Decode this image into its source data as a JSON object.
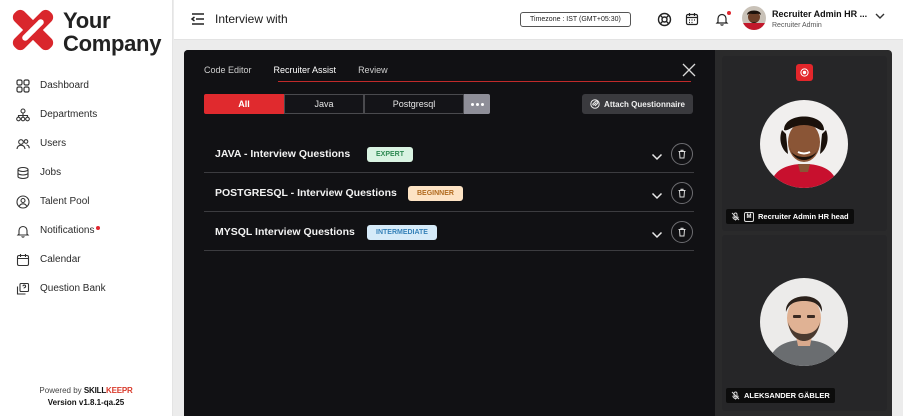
{
  "brand": {
    "logo_line1": "Your",
    "logo_line2": "Company",
    "powered_by": "Powered by",
    "skill": "SKILL",
    "keepr": "KEEPR",
    "version": "Version v1.8.1-qa.25"
  },
  "sidebar": {
    "items": [
      {
        "label": "Dashboard",
        "icon": "dashboard-icon"
      },
      {
        "label": "Departments",
        "icon": "departments-icon"
      },
      {
        "label": "Users",
        "icon": "users-icon"
      },
      {
        "label": "Jobs",
        "icon": "jobs-icon"
      },
      {
        "label": "Talent Pool",
        "icon": "talent-pool-icon"
      },
      {
        "label": "Notifications",
        "icon": "bell-icon"
      },
      {
        "label": "Calendar",
        "icon": "calendar-icon"
      },
      {
        "label": "Question Bank",
        "icon": "question-bank-icon"
      }
    ]
  },
  "header": {
    "title": "Interview with",
    "timezone": "Timezone : IST (GMT+05:30)",
    "user_name": "Recruiter Admin HR ...",
    "user_role": "Recruiter Admin"
  },
  "panel": {
    "tabs": [
      "Code Editor",
      "Recruiter Assist",
      "Review"
    ],
    "active_tab": "Recruiter Assist",
    "filters": [
      "All",
      "Java",
      "Postgresql"
    ],
    "active_filter": "All",
    "attach_label": "Attach Questionnaire",
    "questionnaires": [
      {
        "title": "JAVA - Interview Questions",
        "level": "EXPERT"
      },
      {
        "title": "POSTGRESQL - Interview Questions",
        "level": "BEGINNER"
      },
      {
        "title": "MYSQL Interview Questions",
        "level": "INTERMEDIATE"
      }
    ]
  },
  "video": {
    "participants": [
      {
        "name": "Recruiter Admin HR head",
        "badge": "M"
      },
      {
        "name": "ALEKSANDER GÄBLER"
      }
    ]
  },
  "colors": {
    "accent": "#e02a2e",
    "panel_bg": "#111114",
    "tile_bg": "#262628",
    "expert": "#d9f3e2",
    "beginner": "#fde3c4",
    "intermediate": "#d6ebf9"
  }
}
